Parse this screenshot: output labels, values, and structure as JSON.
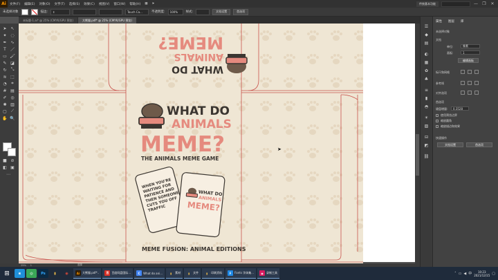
{
  "app": {
    "logo": "Ai"
  },
  "menu": {
    "items": [
      "文件(F)",
      "编辑(E)",
      "对象(O)",
      "文字(T)",
      "选择(S)",
      "效果(C)",
      "视图(V)",
      "窗口(W)",
      "帮助(H)"
    ],
    "workspace": "传统基本功能",
    "window_controls": [
      "—",
      "❐",
      "✕"
    ]
  },
  "control_bar": {
    "selection_label": "未选择对象",
    "stroke_label": "描边:",
    "brush_label": "Touch Ca...",
    "style_label": "不透明度:",
    "opacity_value": "100%",
    "style2_label": "样式:",
    "doc_setup_button": "文档设置",
    "prefs_button": "首选项"
  },
  "tabs": [
    {
      "label": "未标题-1.ai* @ 25% (CMYK/GPU 预览)",
      "active": false
    },
    {
      "label": "大熊猫.pdf* @ 25% (CMYK/GPU 预览)",
      "active": true
    }
  ],
  "artwork": {
    "title_top": "WHAT DO",
    "title_mid": "ANIMALS",
    "title_big": "MEME?",
    "subtitle": "THE ANIMALS MEME GAME",
    "card1_text": [
      "WHEN YOU'RE",
      "WAITING FOR",
      "PATIENCE AND",
      "THEN SOMEONE",
      "CUTS YOU OFF",
      "TRAFFIC"
    ],
    "card2_top": "WHAT DO",
    "card2_mid": "ANIMALS",
    "card2_big": "MEME?",
    "footer": "MEME FUSION: ANIMAL EDITIONS",
    "colors": {
      "dark": "#3a3530",
      "coral": "#e58a7e",
      "bg": "#efe6d4",
      "paw": "#e5d7c0",
      "dieline": "#c9534c"
    }
  },
  "panel": {
    "tabs": [
      "属性",
      "图层",
      "库"
    ],
    "no_selection": "未选择对象",
    "doc_label": "文档",
    "units_label": "单位:",
    "units_value": "像素",
    "artboard_label": "画板:",
    "artboard_value": "1",
    "edit_artboard_button": "编辑画板",
    "ruler_label": "标尺和网格",
    "guides_label": "参考线",
    "align_label": "对齐选项",
    "prefs_label": "首选项",
    "keyboard_label": "键盘增量:",
    "keyboard_value": "0.3528",
    "check1": "使用预览边界",
    "check2": "缩放圆角",
    "check3": "缩放描边和效果",
    "quick_label": "快速操作",
    "quick_doc_setup": "文档设置",
    "quick_prefs": "首选项"
  },
  "status": {
    "zoom": "25%",
    "artboard": "1",
    "tool": "选择"
  },
  "taskbar": {
    "apps": [
      {
        "label": "大熊猫.pdf*..",
        "icon": "Ai",
        "color": "#ff9a00"
      },
      {
        "label": "百度网盘国际...",
        "icon": "百",
        "color": "#d93025"
      },
      {
        "label": "What do ani...",
        "icon": "C",
        "color": "#4285f4"
      },
      {
        "label": "素材",
        "icon": "▮",
        "color": "#e8b84a"
      },
      {
        "label": "文件",
        "icon": "▮",
        "color": "#e8b84a"
      },
      {
        "label": "印刷资料",
        "icon": "▮",
        "color": "#e8b84a"
      },
      {
        "label": "Fonts 字体集...",
        "icon": "F",
        "color": "#1e88e5"
      },
      {
        "label": "录制工具",
        "icon": "◉",
        "color": "#d81b60"
      }
    ],
    "pinned": [
      {
        "name": "ie-icon",
        "icon": "e",
        "color": "#1f8fd8"
      },
      {
        "name": "360-icon",
        "icon": "◎",
        "color": "#3aa757"
      },
      {
        "name": "photoshop-icon",
        "icon": "Ps",
        "color": "#0b2a43"
      },
      {
        "name": "folder-icon",
        "icon": "▮",
        "color": "#e8b84a"
      },
      {
        "name": "chrome-icon",
        "icon": "◉",
        "color": "#2f8f46"
      }
    ],
    "clock_time": "10:23",
    "clock_date": "2021/12/15"
  }
}
